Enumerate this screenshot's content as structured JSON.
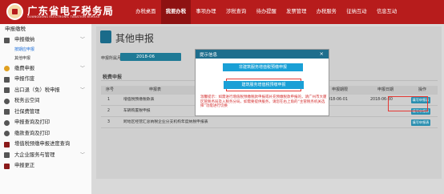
{
  "header": {
    "brand_cn": "广东省电子税务局",
    "brand_en": "GUANGDONG ELECTRONIC TAXATION BUREAU",
    "nav": [
      {
        "label": "办税桌面",
        "active": false
      },
      {
        "label": "我要办税",
        "active": true
      },
      {
        "label": "事项办理",
        "active": false
      },
      {
        "label": "涉税查询",
        "active": false
      },
      {
        "label": "待办提醒",
        "active": false
      },
      {
        "label": "发票管理",
        "active": false
      },
      {
        "label": "办税服务",
        "active": false
      },
      {
        "label": "征纳互动",
        "active": false
      },
      {
        "label": "信息互动",
        "active": false
      }
    ],
    "accent": "#b71c1c"
  },
  "sidebar": {
    "title": "申报缴税",
    "items": [
      {
        "label": "申报缴纳",
        "icon": "form-icon",
        "chevron": "﹀"
      },
      {
        "label": "缴费申报",
        "icon": "coin-icon",
        "chevron": "﹀"
      },
      {
        "label": "申报作废",
        "icon": "trash-icon",
        "chevron": ""
      },
      {
        "label": "出口退（免）税申报",
        "icon": "export-icon",
        "chevron": "﹀"
      },
      {
        "label": "税务云空间",
        "icon": "cloud-icon",
        "chevron": ""
      },
      {
        "label": "社保费管理",
        "icon": "shield-icon",
        "chevron": ""
      },
      {
        "label": "申报查询及打印",
        "icon": "search-icon",
        "chevron": ""
      },
      {
        "label": "缴款查询及打印",
        "icon": "receipt-icon",
        "chevron": ""
      },
      {
        "label": "增值税预缴申报进度查询",
        "icon": "progress-icon",
        "chevron": ""
      },
      {
        "label": "大企业服务与管理",
        "icon": "building-icon",
        "chevron": "﹀"
      },
      {
        "label": "申报更正",
        "icon": "edit-icon",
        "chevron": ""
      }
    ],
    "subitems": [
      "按期应申报",
      "其他申报"
    ]
  },
  "main": {
    "title": "其他申报",
    "period_label": "申报所属月份：",
    "period_value": "2018-06",
    "section_label": "税费申报",
    "columns": [
      "序号",
      "申报表",
      "申报期限",
      "申报日期",
      "操作"
    ],
    "rows": [
      {
        "index": "1",
        "name": "增值税预缴税款表",
        "start": "2018-06-01",
        "date": "2018-06-30",
        "op": "填写申报表"
      },
      {
        "index": "2",
        "name": "车辆购置税申报",
        "start": "",
        "date": "",
        "op": "填写申报表"
      },
      {
        "index": "3",
        "name": "跨地区经营汇总纳税企业分支机构年度纳税申报表",
        "start": "",
        "date": "",
        "op": "填写申报表"
      }
    ]
  },
  "modal": {
    "title": "提示信息",
    "close": "×",
    "btn1": "非建筑服务增值税预缴申报",
    "btn2": "建筑服务增值税预缴申报",
    "notice": "温馨提示：如需进行增值税预缴税款申报或补充预缴税款申报的，请广州市大厦区管税务局及入税务分局，如需要提供服务，请您在右上角的“主管税务机关选择”功能进行切换"
  }
}
